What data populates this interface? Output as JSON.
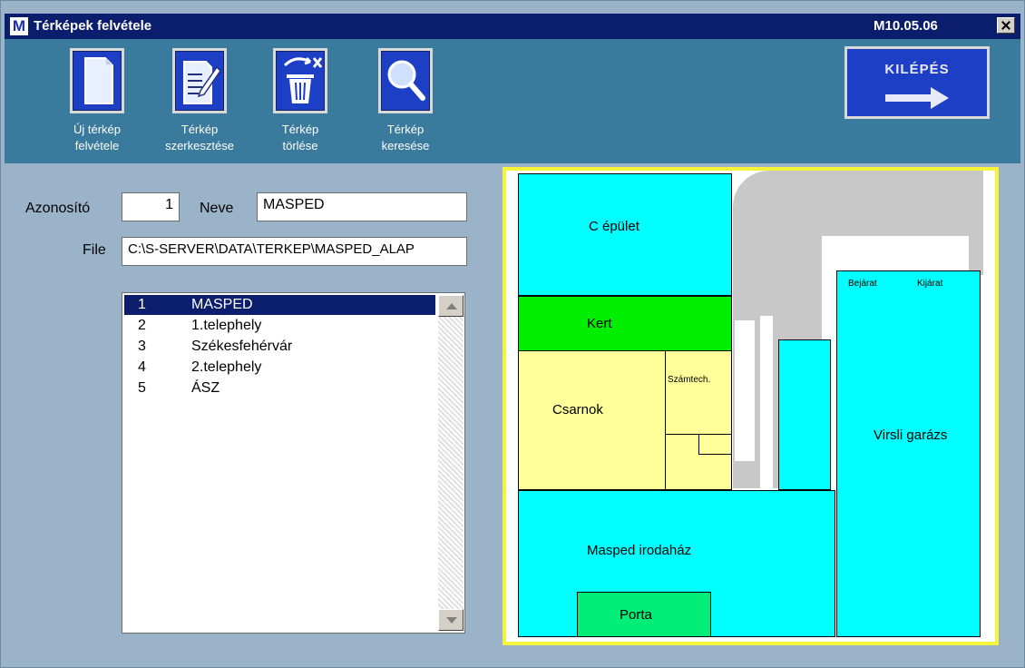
{
  "window": {
    "app_icon": "M",
    "title": "Térképek felvétele",
    "version": "M10.05.06"
  },
  "toolbar": {
    "buttons": [
      {
        "icon": "new-document-icon",
        "line1": "Új térkép",
        "line2": "felvétele"
      },
      {
        "icon": "edit-document-icon",
        "line1": "Térkép",
        "line2": "szerkesztése"
      },
      {
        "icon": "trash-icon",
        "line1": "Térkép",
        "line2": "törlése"
      },
      {
        "icon": "magnifier-icon",
        "line1": "Térkép",
        "line2": "keresése"
      }
    ],
    "exit_label": "KILÉPÉS"
  },
  "form": {
    "id_label": "Azonosító",
    "id_value": "1",
    "name_label": "Neve",
    "name_value": "MASPED",
    "file_label": "File",
    "file_value": "C:\\S-SERVER\\DATA\\TERKEP\\MASPED_ALAP"
  },
  "list": {
    "selected_index": 0,
    "items": [
      {
        "num": "1",
        "name": "MASPED"
      },
      {
        "num": "2",
        "name": "1.telephely"
      },
      {
        "num": "3",
        "name": "Székesfehérvár"
      },
      {
        "num": "4",
        "name": "2.telephely"
      },
      {
        "num": "5",
        "name": "ÁSZ"
      }
    ]
  },
  "map": {
    "labels": {
      "c_epulet": "C épület",
      "kert": "Kert",
      "csarnok": "Csarnok",
      "szamtech": "Számtech.",
      "masped_irodahaz": "Masped irodaház",
      "porta": "Porta",
      "virsli_garazs": "Virsli garázs",
      "bejarat": "Bejárat",
      "kijarat": "Kijárat"
    },
    "colors": {
      "cyan": "#00ffff",
      "green": "#00ee00",
      "yellow": "#ffff99",
      "porta": "#00ee77",
      "road": "#c8c8c8",
      "border": "#f5f33a"
    }
  }
}
